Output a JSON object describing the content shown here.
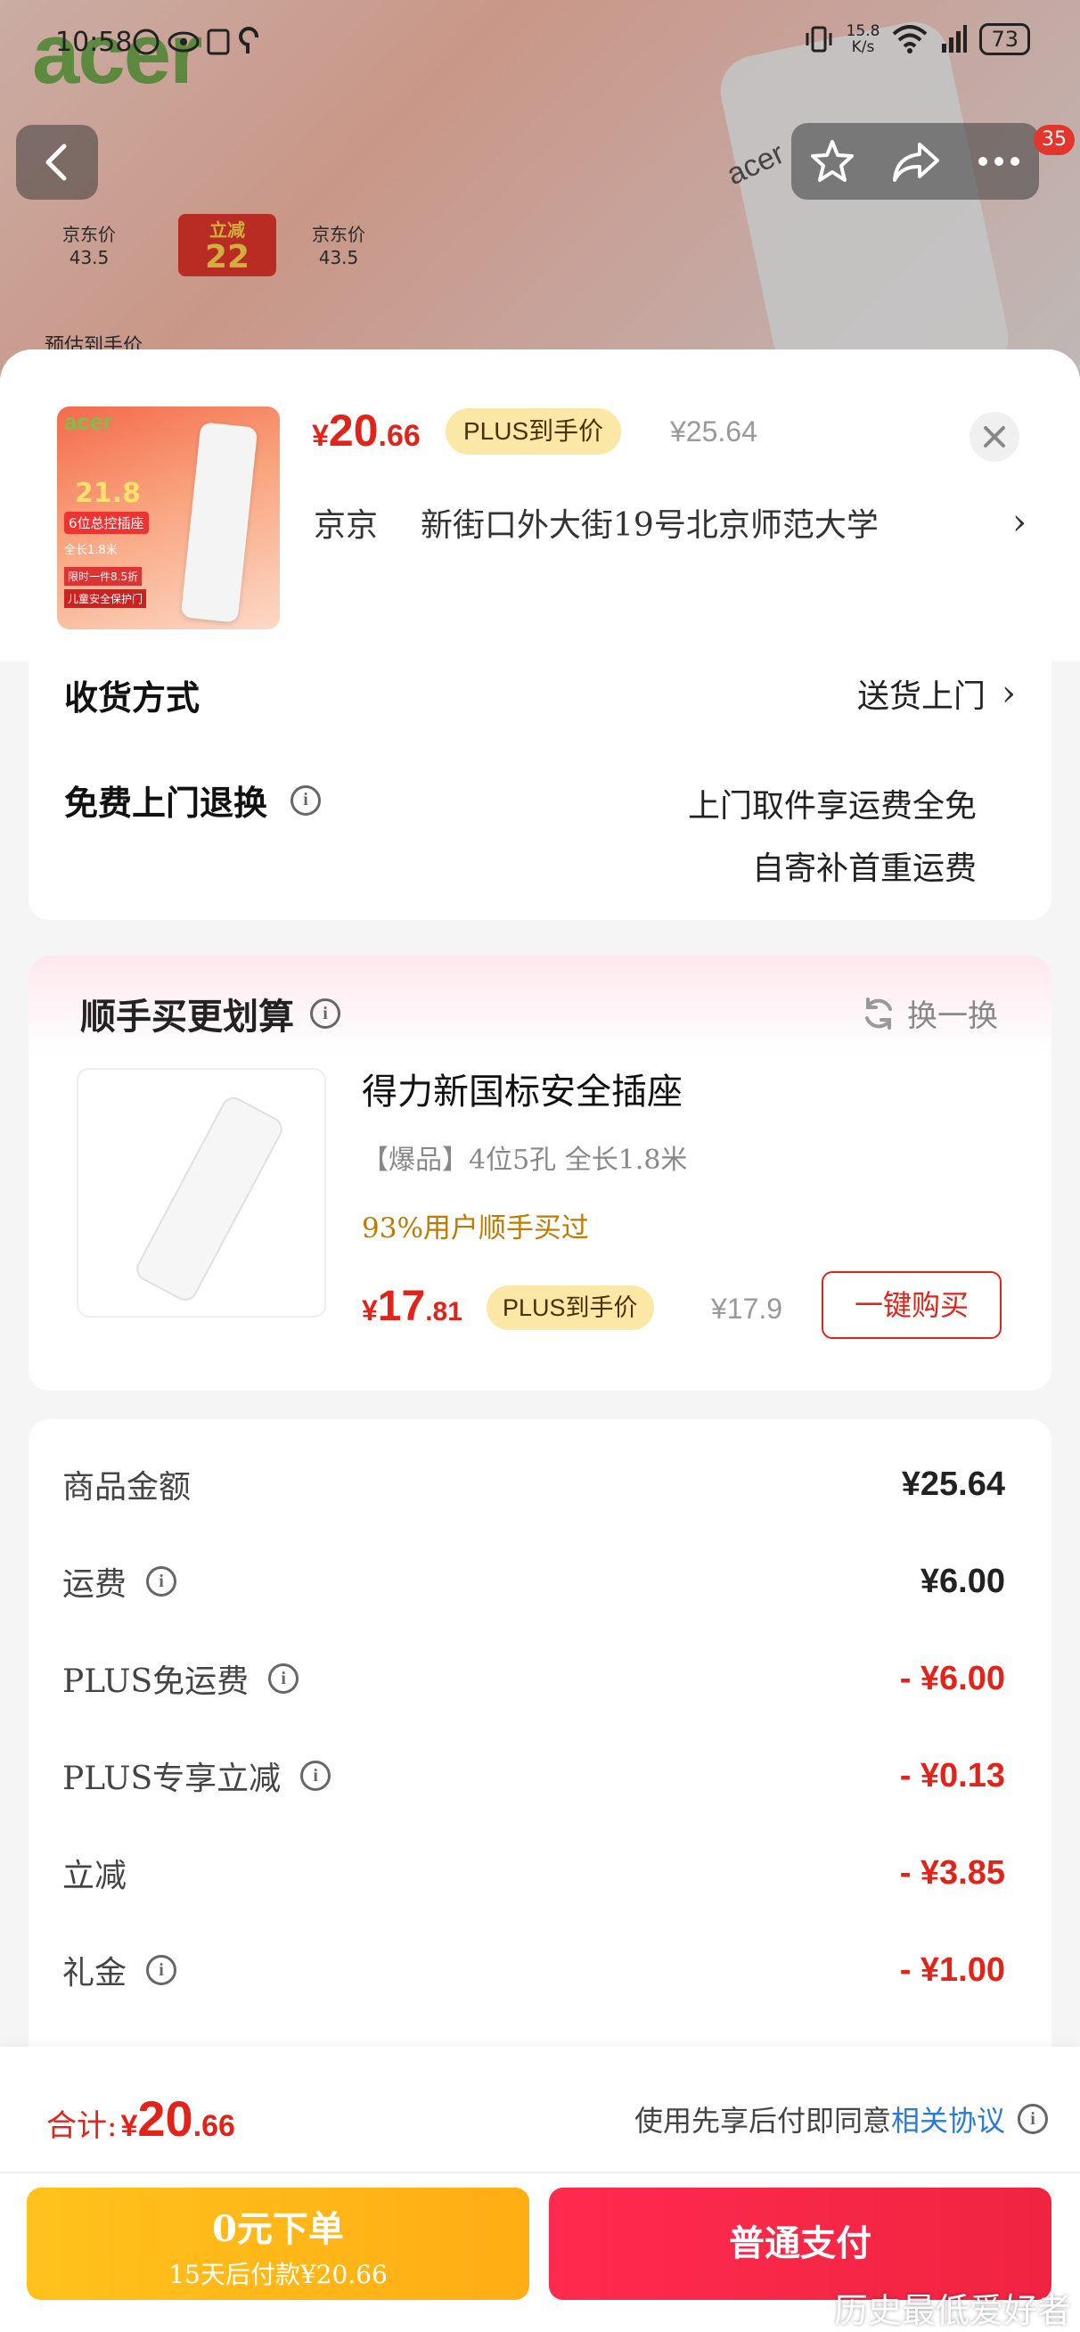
{
  "status_bar": {
    "time": "10:58",
    "network_speed_value": "15.8",
    "network_speed_unit": "K/s",
    "battery": "73"
  },
  "hero": {
    "brand_logo": "acer",
    "left_price_label": "京东价",
    "left_price": "43.5",
    "badge_label": "立减",
    "badge_value": "22",
    "right_price_label": "京东价",
    "right_price": "43.5",
    "estimate_label": "预估到手价",
    "strip_logo": "acer"
  },
  "nav": {
    "badge_count": "35",
    "icons": [
      "back-icon",
      "star-icon",
      "share-icon",
      "more-icon"
    ]
  },
  "sheet_header": {
    "price_currency": "¥",
    "price_int": "20",
    "price_dec": ".66",
    "plus_tag": "PLUS到手价",
    "original_price": "¥25.64",
    "receiver": "京京",
    "address": "新街口外大街19号北京师范大学",
    "thumbnail": {
      "brand": "acer",
      "price": "21.8",
      "line1": "6位总控插座",
      "line2": "全长1.8米",
      "line3": "限时一件8.5折",
      "line4": "儿童安全保护门"
    }
  },
  "delivery": {
    "method_label": "收货方式",
    "method_value": "送货上门",
    "return_label": "免费上门退换",
    "return_value_1": "上门取件享运费全免",
    "return_value_2": "自寄补首重运费"
  },
  "recommend": {
    "title": "顺手买更划算",
    "swap_label": "换一换",
    "product_name": "得力新国标安全插座",
    "spec": "【爆品】4位5孔  全长1.8米",
    "buyers": "93%用户顺手买过",
    "price_currency": "¥",
    "price_int": "17",
    "price_dec": ".81",
    "plus_tag": "PLUS到手价",
    "original_price": "¥17.9",
    "buy_button": "一键购买"
  },
  "fees": [
    {
      "label": "商品金额",
      "value": "¥25.64",
      "info": false,
      "red": false
    },
    {
      "label": "运费",
      "value": "¥6.00",
      "info": true,
      "red": false
    },
    {
      "label": "PLUS免运费",
      "value": "- ¥6.00",
      "info": true,
      "red": true
    },
    {
      "label": "PLUS专享立减",
      "value": "- ¥0.13",
      "info": true,
      "red": true
    },
    {
      "label": "立减",
      "value": "- ¥3.85",
      "info": false,
      "red": true
    },
    {
      "label": "礼金",
      "value": "- ¥1.00",
      "info": true,
      "red": true
    }
  ],
  "bottom": {
    "total_label": "合计:",
    "total_currency": "¥",
    "total_int": "20",
    "total_dec": ".66",
    "agree_text": "使用先享后付即同意",
    "agree_link": "相关协议",
    "pay_later_title": "0元下单",
    "pay_later_sub": "15天后付款¥20.66",
    "pay_now": "普通支付",
    "watermark": "历史最低爱好者"
  },
  "colors": {
    "accent_red": "#e2231a",
    "plus_gold": "#fbe7a6",
    "link_blue": "#2b7bd6",
    "pay_later_yellow": "#ffc21c",
    "pay_now_red": "#ff2a4f"
  }
}
